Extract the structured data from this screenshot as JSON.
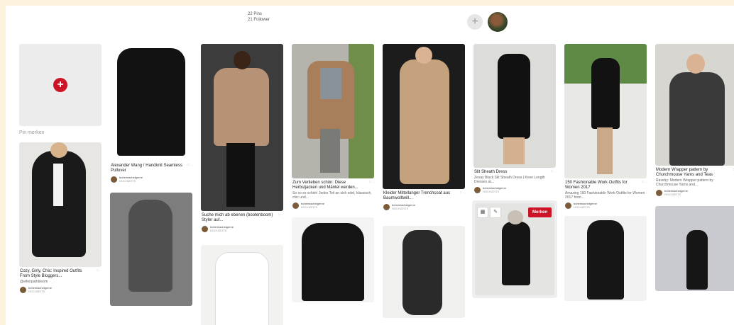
{
  "header": {
    "pins": "22 Pins",
    "followers": "21 Follower",
    "add_icon": "plus-icon",
    "avatar_icon": "user-avatar"
  },
  "add_pin": {
    "label": "Pin merken"
  },
  "pins": {
    "p2": {
      "title": "Alexander Wang / Handknit Seamless Pullover",
      "likes": "♡ ·",
      "user": "bohemiacheigerne",
      "sub": "HOCHZEITS"
    },
    "p3": {
      "title": "Cozy, Girly, Chic: Inspired Outfits From Style Bloggers...",
      "desc": "@elfenpathbloom",
      "likes": "♡ ·",
      "user": "bohemiacheigerne",
      "sub": "HOCHZEITS"
    },
    "p5": {
      "title": "Suche mich ab ebenen (bootenboom) Styler auf...",
      "likes": "♡ ·",
      "user": "bohemiacheigerne",
      "sub": "HOCHZEITS"
    },
    "p7": {
      "title": "Zum Verlieben schön: Diese Herbstjacken und Mäntel werden...",
      "desc": "So so so schön! Jedes Teil an sich edel, klassisch, chic und...",
      "likes": "♡ ·",
      "user": "bohemiacheigerne",
      "sub": "HOCHZEITS"
    },
    "p9": {
      "title": "Kleider Mittellanger Trenchcoat aus Baumwolltwill...",
      "likes": "♡ ·",
      "user": "bohemiacheigerne",
      "sub": "HOCHZEITS"
    },
    "p11": {
      "title": "Slit Sheath Dress",
      "desc": "Zesay Black Slit Sheath Dress | Knee Length Dresses at...",
      "likes": "♡ ·",
      "user": "bohemiacheigerne",
      "sub": "HOCHZEITS"
    },
    "p12": {
      "merken": "Merken",
      "icon_a": "chart-icon",
      "icon_b": "pencil-icon"
    },
    "p13": {
      "title": "150 Fashionable Work Outfits for Women 2017",
      "desc": "Amazing 150 Fashionable Work Outfits for Women 2017 from...",
      "likes": "♡ ·",
      "user": "bohemiacheigerne",
      "sub": "HOCHZEITS"
    },
    "p15": {
      "title": "Modern Wrapper pattern by Churchmouse Yarns and Teas",
      "desc": "Ravelry: Modern Wrapper pattern by Churchmouse Yarns and...",
      "likes": "♡ ·",
      "user": "bohemiacheigerne",
      "sub": "HOCHZEITS"
    }
  },
  "colors": {
    "background": "#fdf3dc",
    "accent": "#cc1426"
  }
}
